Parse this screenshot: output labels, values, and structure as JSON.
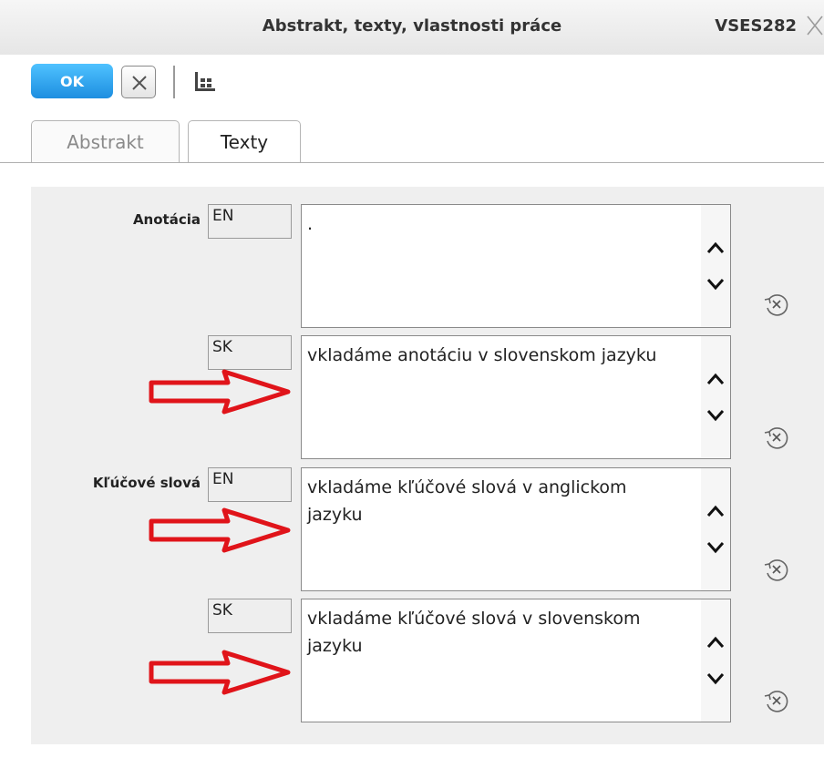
{
  "window": {
    "title": "Abstrakt, texty, vlastnosti práce",
    "code": "VSES282"
  },
  "toolbar": {
    "ok_label": "OK",
    "cancel_icon": "close-x-icon",
    "grid_icon": "table-grid-icon"
  },
  "tabs": [
    {
      "label": "Abstrakt",
      "active": false
    },
    {
      "label": "Texty",
      "active": true
    }
  ],
  "fields": [
    {
      "group_label": "Anotácia",
      "lang": "EN",
      "value": "."
    },
    {
      "group_label": "",
      "lang": "SK",
      "value": "vkladáme anotáciu v slovenskom jazyku"
    },
    {
      "group_label": "Kľúčové slová",
      "lang": "EN",
      "value": "vkladáme kľúčové slová v anglickom jazyku"
    },
    {
      "group_label": "",
      "lang": "SK",
      "value": "vkladáme kľúčové slová v slovenskom jazyku"
    }
  ],
  "colors": {
    "ok_button": "#1d8ee0",
    "annotation_arrow": "#e0141a"
  }
}
